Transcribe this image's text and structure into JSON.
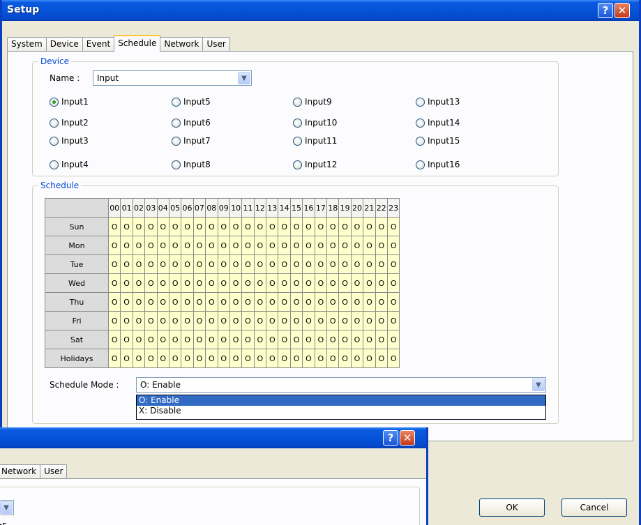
{
  "window": {
    "title": "Setup",
    "help_label": "?",
    "close_label": "✕",
    "tabs": [
      "System",
      "Device",
      "Event",
      "Schedule",
      "Network",
      "User"
    ],
    "active_tab": "Schedule"
  },
  "device": {
    "group_title": "Device",
    "name_label": "Name :",
    "name_value": "Input",
    "selected_input": "Input1",
    "inputs": [
      "Input1",
      "Input2",
      "Input3",
      "Input4",
      "Input5",
      "Input6",
      "Input7",
      "Input8",
      "Input9",
      "Input10",
      "Input11",
      "Input12",
      "Input13",
      "Input14",
      "Input15",
      "Input16"
    ]
  },
  "schedule": {
    "group_title": "Schedule",
    "hours": [
      "00",
      "01",
      "02",
      "03",
      "04",
      "05",
      "06",
      "07",
      "08",
      "09",
      "10",
      "11",
      "12",
      "13",
      "14",
      "15",
      "16",
      "17",
      "18",
      "19",
      "20",
      "21",
      "22",
      "23"
    ],
    "days": [
      "Sun",
      "Mon",
      "Tue",
      "Wed",
      "Thu",
      "Fri",
      "Sat",
      "Holidays"
    ],
    "cell_value": "O",
    "mode_label": "Schedule Mode :",
    "mode_value": "O: Enable",
    "mode_options": [
      "O: Enable",
      "X: Disable"
    ],
    "mode_selected_option": "O: Enable"
  },
  "buttons": {
    "ok": "OK",
    "cancel": "Cancel"
  },
  "window2": {
    "help_label": "?",
    "close_label": "✕",
    "tabs": [
      "Network",
      "User"
    ],
    "partial_text": "t5"
  },
  "colors": {
    "titlebar": "#0553d8",
    "dialog_bg": "#ece9d8",
    "cell_bg": "#ffffcc",
    "group_title": "#0046d5",
    "selection": "#316ac5"
  }
}
